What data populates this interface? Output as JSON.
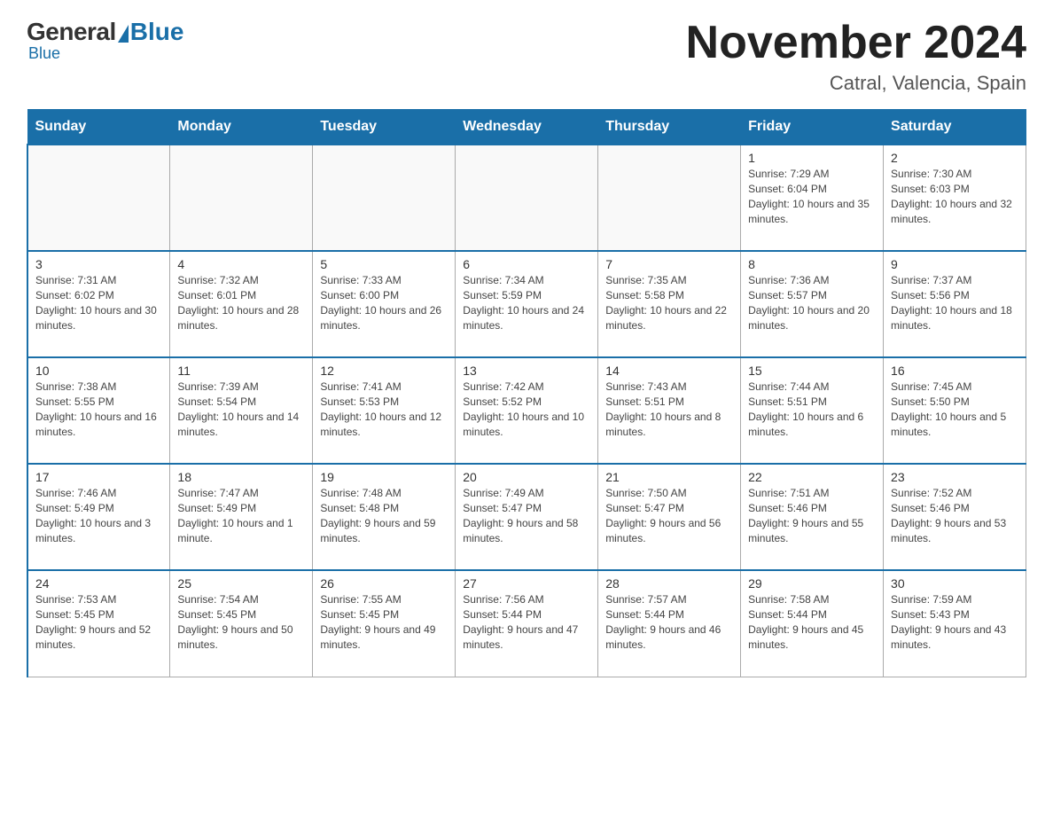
{
  "logo": {
    "general": "General",
    "blue": "Blue"
  },
  "header": {
    "title": "November 2024",
    "location": "Catral, Valencia, Spain"
  },
  "weekdays": [
    "Sunday",
    "Monday",
    "Tuesday",
    "Wednesday",
    "Thursday",
    "Friday",
    "Saturday"
  ],
  "weeks": [
    [
      {
        "day": "",
        "info": ""
      },
      {
        "day": "",
        "info": ""
      },
      {
        "day": "",
        "info": ""
      },
      {
        "day": "",
        "info": ""
      },
      {
        "day": "",
        "info": ""
      },
      {
        "day": "1",
        "info": "Sunrise: 7:29 AM\nSunset: 6:04 PM\nDaylight: 10 hours and 35 minutes."
      },
      {
        "day": "2",
        "info": "Sunrise: 7:30 AM\nSunset: 6:03 PM\nDaylight: 10 hours and 32 minutes."
      }
    ],
    [
      {
        "day": "3",
        "info": "Sunrise: 7:31 AM\nSunset: 6:02 PM\nDaylight: 10 hours and 30 minutes."
      },
      {
        "day": "4",
        "info": "Sunrise: 7:32 AM\nSunset: 6:01 PM\nDaylight: 10 hours and 28 minutes."
      },
      {
        "day": "5",
        "info": "Sunrise: 7:33 AM\nSunset: 6:00 PM\nDaylight: 10 hours and 26 minutes."
      },
      {
        "day": "6",
        "info": "Sunrise: 7:34 AM\nSunset: 5:59 PM\nDaylight: 10 hours and 24 minutes."
      },
      {
        "day": "7",
        "info": "Sunrise: 7:35 AM\nSunset: 5:58 PM\nDaylight: 10 hours and 22 minutes."
      },
      {
        "day": "8",
        "info": "Sunrise: 7:36 AM\nSunset: 5:57 PM\nDaylight: 10 hours and 20 minutes."
      },
      {
        "day": "9",
        "info": "Sunrise: 7:37 AM\nSunset: 5:56 PM\nDaylight: 10 hours and 18 minutes."
      }
    ],
    [
      {
        "day": "10",
        "info": "Sunrise: 7:38 AM\nSunset: 5:55 PM\nDaylight: 10 hours and 16 minutes."
      },
      {
        "day": "11",
        "info": "Sunrise: 7:39 AM\nSunset: 5:54 PM\nDaylight: 10 hours and 14 minutes."
      },
      {
        "day": "12",
        "info": "Sunrise: 7:41 AM\nSunset: 5:53 PM\nDaylight: 10 hours and 12 minutes."
      },
      {
        "day": "13",
        "info": "Sunrise: 7:42 AM\nSunset: 5:52 PM\nDaylight: 10 hours and 10 minutes."
      },
      {
        "day": "14",
        "info": "Sunrise: 7:43 AM\nSunset: 5:51 PM\nDaylight: 10 hours and 8 minutes."
      },
      {
        "day": "15",
        "info": "Sunrise: 7:44 AM\nSunset: 5:51 PM\nDaylight: 10 hours and 6 minutes."
      },
      {
        "day": "16",
        "info": "Sunrise: 7:45 AM\nSunset: 5:50 PM\nDaylight: 10 hours and 5 minutes."
      }
    ],
    [
      {
        "day": "17",
        "info": "Sunrise: 7:46 AM\nSunset: 5:49 PM\nDaylight: 10 hours and 3 minutes."
      },
      {
        "day": "18",
        "info": "Sunrise: 7:47 AM\nSunset: 5:49 PM\nDaylight: 10 hours and 1 minute."
      },
      {
        "day": "19",
        "info": "Sunrise: 7:48 AM\nSunset: 5:48 PM\nDaylight: 9 hours and 59 minutes."
      },
      {
        "day": "20",
        "info": "Sunrise: 7:49 AM\nSunset: 5:47 PM\nDaylight: 9 hours and 58 minutes."
      },
      {
        "day": "21",
        "info": "Sunrise: 7:50 AM\nSunset: 5:47 PM\nDaylight: 9 hours and 56 minutes."
      },
      {
        "day": "22",
        "info": "Sunrise: 7:51 AM\nSunset: 5:46 PM\nDaylight: 9 hours and 55 minutes."
      },
      {
        "day": "23",
        "info": "Sunrise: 7:52 AM\nSunset: 5:46 PM\nDaylight: 9 hours and 53 minutes."
      }
    ],
    [
      {
        "day": "24",
        "info": "Sunrise: 7:53 AM\nSunset: 5:45 PM\nDaylight: 9 hours and 52 minutes."
      },
      {
        "day": "25",
        "info": "Sunrise: 7:54 AM\nSunset: 5:45 PM\nDaylight: 9 hours and 50 minutes."
      },
      {
        "day": "26",
        "info": "Sunrise: 7:55 AM\nSunset: 5:45 PM\nDaylight: 9 hours and 49 minutes."
      },
      {
        "day": "27",
        "info": "Sunrise: 7:56 AM\nSunset: 5:44 PM\nDaylight: 9 hours and 47 minutes."
      },
      {
        "day": "28",
        "info": "Sunrise: 7:57 AM\nSunset: 5:44 PM\nDaylight: 9 hours and 46 minutes."
      },
      {
        "day": "29",
        "info": "Sunrise: 7:58 AM\nSunset: 5:44 PM\nDaylight: 9 hours and 45 minutes."
      },
      {
        "day": "30",
        "info": "Sunrise: 7:59 AM\nSunset: 5:43 PM\nDaylight: 9 hours and 43 minutes."
      }
    ]
  ]
}
